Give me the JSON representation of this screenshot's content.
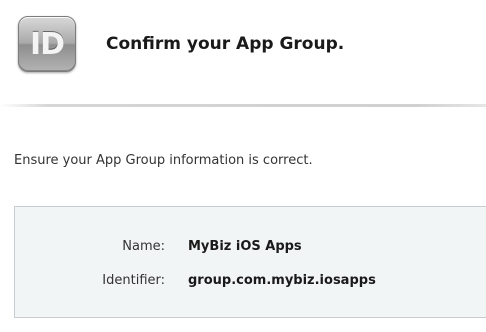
{
  "header": {
    "icon_text": "ID",
    "icon_name": "id-badge-icon",
    "title": "Confirm your App Group."
  },
  "main": {
    "instruction": "Ensure your App Group information is correct.",
    "info": {
      "name_label": "Name:",
      "name_value": "MyBiz iOS Apps",
      "identifier_label": "Identifier:",
      "identifier_value": "group.com.mybiz.iosapps"
    }
  },
  "colors": {
    "panel_background": "#f2f5f6",
    "panel_border": "#c9cdd0",
    "text": "#222222"
  }
}
